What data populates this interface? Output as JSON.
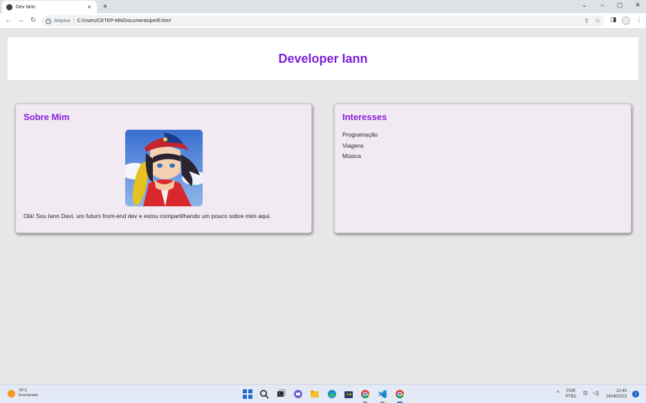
{
  "browser": {
    "tab_title": "Dev Iann",
    "tab_close": "×",
    "new_tab": "+",
    "window_controls": {
      "dropdown": "⌄",
      "minimize": "–",
      "restore": "▢",
      "close": "✕"
    },
    "nav": {
      "back": "←",
      "forward": "→",
      "reload": "↻"
    },
    "address": {
      "protocol_label": "Arquivo",
      "separator": "|",
      "url": "C:/Users/CETEP-MN/Documents/perfil.html"
    },
    "toolbar_icons": [
      "share-icon",
      "star-icon",
      "side-panel-icon",
      "profile-icon",
      "menu-icon"
    ]
  },
  "page": {
    "header_title": "Developer Iann",
    "about": {
      "title": "Sobre Mim",
      "image_alt": "anime style profile picture",
      "text": "Olá! Sou Iann Davi, um futuro front-end dev e estou compartilhando um pouco sobre mim aqui."
    },
    "interests": {
      "title": "Interesses",
      "items": [
        "Programação",
        "Viagens",
        "Música"
      ]
    }
  },
  "taskbar": {
    "weather": {
      "temp": "29°C",
      "condition": "Ensolarado"
    },
    "apps": [
      "windows-start-icon",
      "search-icon",
      "task-view-icon",
      "chat-icon",
      "file-explorer-icon",
      "edge-icon",
      "store-icon",
      "chrome-icon",
      "vscode-icon",
      "chrome-active-icon"
    ],
    "tray": {
      "chevron": "^",
      "lang_top": "POR",
      "lang_bottom": "PTB2",
      "time": "10:40",
      "date": "24/08/2023",
      "notifications": "1"
    }
  },
  "colors": {
    "title_purple": "#7a1fd6",
    "card_bg": "#f1eaf3",
    "page_bg": "#e7e7e7"
  }
}
